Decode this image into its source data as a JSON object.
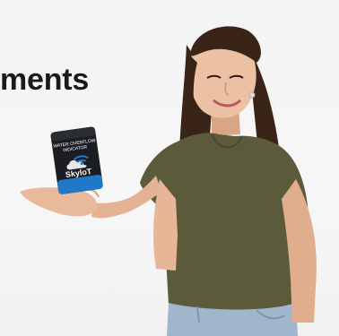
{
  "page": {
    "heading_text": "ments"
  },
  "device": {
    "header_line1": "WATER OVERFLOW",
    "header_line2": "INDICATOR",
    "brand": "SkyloT"
  },
  "colors": {
    "heading": "#1a1a1a",
    "device_body": "#1b1d22",
    "device_accent_blue": "#1f78c8",
    "shirt": "#5b5a3a",
    "hair": "#3a2418",
    "skin": "#e8b99a",
    "jeans": "#9fb6cc"
  }
}
